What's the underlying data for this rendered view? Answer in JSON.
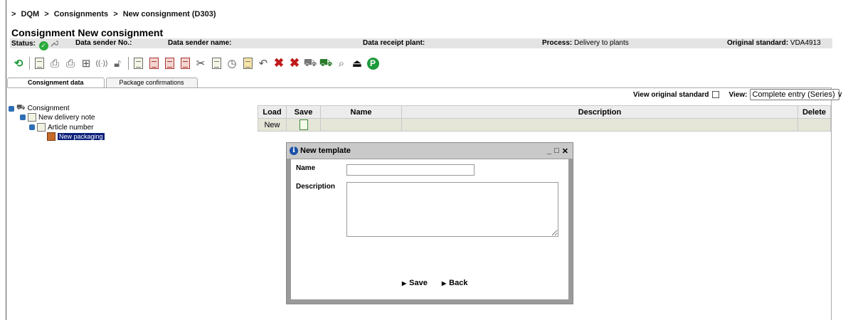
{
  "breadcrumb": [
    ">",
    "DQM",
    ">",
    "Consignments",
    ">",
    "New consignment  (D303)"
  ],
  "page_title": "Consignment New consignment",
  "status_bar": {
    "status_label": "Status:",
    "data_sender_no_label": "Data sender No.:",
    "data_sender_name_label": "Data sender name:",
    "data_receipt_plant_label": "Data receipt plant:",
    "process_label": "Process:",
    "process_value": "Delivery to plants",
    "original_standard_label": "Original standard:",
    "original_standard_value": "VDA4913"
  },
  "toolbar": {
    "icons": [
      "refresh-icon",
      "new-document-icon",
      "print-icon",
      "print-all-icon",
      "structure-icon",
      "signal-icon",
      "unlock-icon",
      "document-icon",
      "document-red-icon",
      "document-red-2-icon",
      "document-red-3-icon",
      "cut-icon",
      "paste-icon",
      "history-icon",
      "export-icon",
      "undo-icon",
      "delete-icon",
      "delete-all-icon",
      "truck-icon",
      "truck-send-icon",
      "preview-icon",
      "weight-icon",
      "parking-icon"
    ]
  },
  "tabs": [
    {
      "label": "Consignment data",
      "active": true
    },
    {
      "label": "Package confirmations",
      "active": false
    }
  ],
  "view_bar": {
    "view_original_label": "View original standard",
    "view_label": "View:",
    "view_value": "Complete entry (Series) ∨"
  },
  "tree": {
    "root": "Consignment",
    "delivery_note": "New delivery note",
    "article": "Article number",
    "packaging": "New packaging"
  },
  "grid": {
    "headers": {
      "load": "Load",
      "save": "Save",
      "name": "Name",
      "description": "Description",
      "delete": "Delete"
    },
    "row": {
      "load": "New"
    }
  },
  "dialog": {
    "title": "New template",
    "controls": [
      "_",
      "□",
      "✕"
    ],
    "name_label": "Name",
    "name_value": "",
    "description_label": "Description",
    "description_value": "",
    "save_label": "Save",
    "back_label": "Back"
  },
  "colors": {
    "accent_green": "#2bab3c",
    "selection_blue": "#0b1f7a",
    "info_blue": "#1a4fa5"
  }
}
